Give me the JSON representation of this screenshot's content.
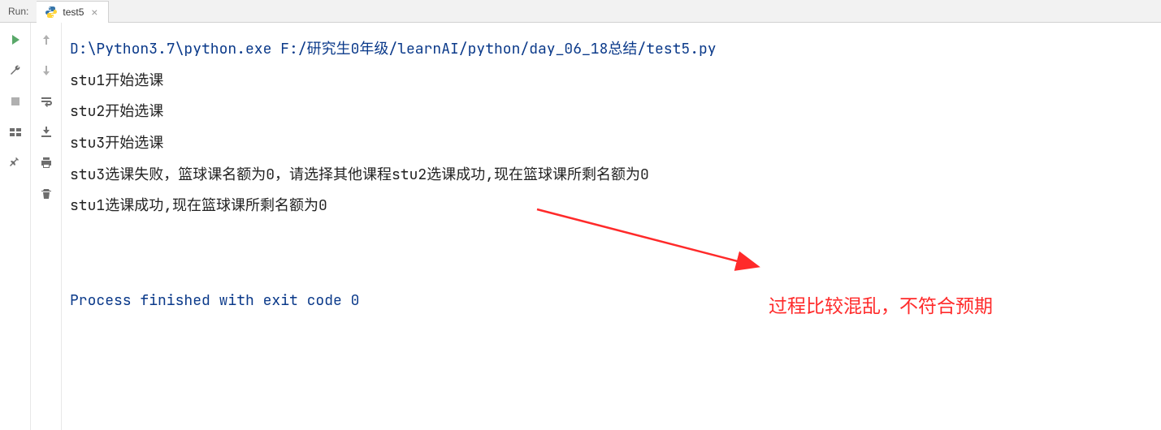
{
  "header": {
    "run_label": "Run:",
    "tab_label": "test5"
  },
  "console": {
    "path": "D:\\Python3.7\\python.exe F:/研究生0年级/learnAI/python/day_06_18总结/test5.py",
    "lines": [
      "stu1开始选课",
      "stu2开始选课",
      "stu3开始选课",
      "stu3选课失败，篮球课名额为0，请选择其他课程stu2选课成功,现在篮球课所剩名额为0",
      "stu1选课成功,现在篮球课所剩名额为0"
    ],
    "exit": "Process finished with exit code 0"
  },
  "annotation": {
    "text": "过程比较混乱，不符合预期"
  }
}
